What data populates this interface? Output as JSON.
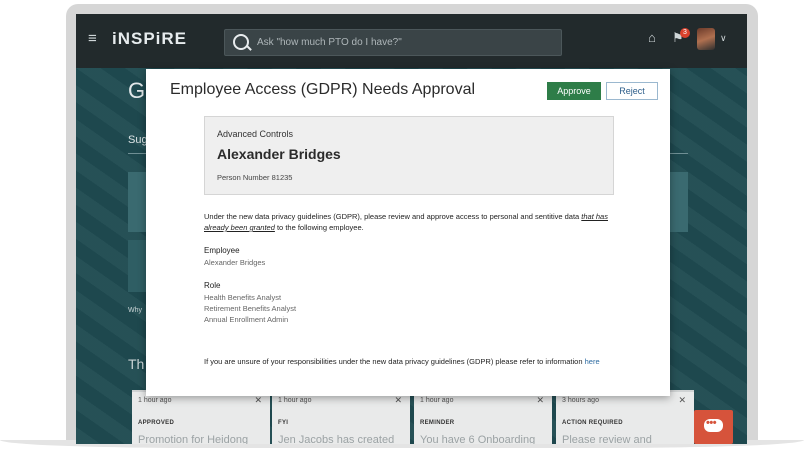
{
  "app": {
    "brand": "iNSPiRE",
    "menu_icon": "hamburger-icon",
    "search_placeholder": "Ask \"how much PTO do I have?\"",
    "notification_count": "3"
  },
  "background_page": {
    "title_fragment": "G",
    "tab_fragment": "Sug",
    "why_fragment": "Why",
    "section_fragment": "Th"
  },
  "cards": [
    {
      "time": "1 hour ago",
      "tag": "APPROVED",
      "text": "Promotion for Heidong"
    },
    {
      "time": "1 hour ago",
      "tag": "FYI",
      "text": "Jen Jacobs has created"
    },
    {
      "time": "1 hour ago",
      "tag": "REMINDER",
      "text": "You have 6 Onboarding"
    },
    {
      "time": "3 hours ago",
      "tag": "ACTION REQUIRED",
      "text": "Please review and"
    }
  ],
  "modal": {
    "title": "Employee Access (GDPR) Needs Approval",
    "approve_label": "Approve",
    "reject_label": "Reject",
    "person": {
      "subtitle": "Advanced Controls",
      "name": "Alexander Bridges",
      "number": "Person Number 81235"
    },
    "description_before": "Under the new data privacy guidelines (GDPR), please review and approve access to personal and sentitive data ",
    "description_emphasis": "that has already been granted",
    "description_after": " to the following employee.",
    "employee_label": "Employee",
    "employee_value": "Alexander Bridges",
    "role_label": "Role",
    "roles": [
      "Health Benefits Analyst",
      "Retirement Benefits Analyst",
      "Annual Enrollment Admin"
    ],
    "footnote_text": "If you are unsure of your responsibilities under the new data privacy guidelines (GDPR) please refer to information ",
    "footnote_link": "here"
  },
  "colors": {
    "topbar": "#222a2c",
    "background": "#1f4b51",
    "approve": "#2e7d48",
    "chat": "#d6533b"
  }
}
